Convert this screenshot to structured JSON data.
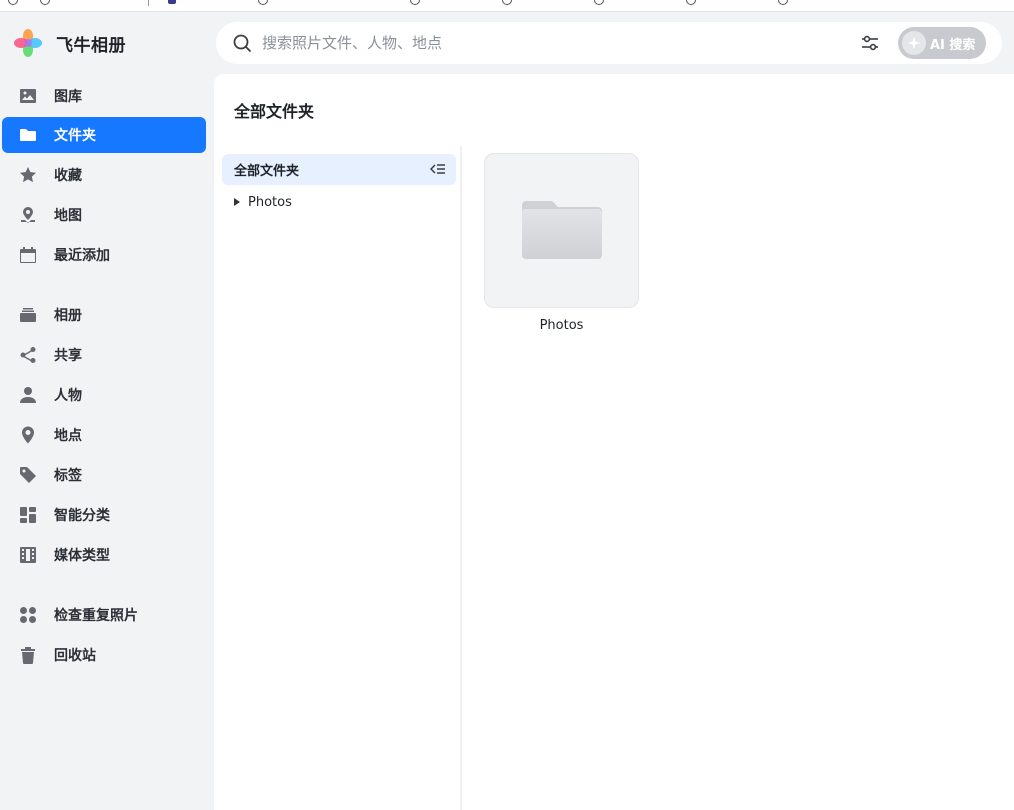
{
  "app": {
    "name": "飞牛相册"
  },
  "search": {
    "placeholder": "搜索照片文件、人物、地点",
    "ai_label": "AI 搜索"
  },
  "nav": {
    "gallery": "图库",
    "folders": "文件夹",
    "favorites": "收藏",
    "map": "地图",
    "recent": "最近添加",
    "albums": "相册",
    "share": "共享",
    "people": "人物",
    "places": "地点",
    "tags": "标签",
    "smart": "智能分类",
    "media_types": "媒体类型",
    "duplicates": "检查重复照片",
    "trash": "回收站"
  },
  "main": {
    "title": "全部文件夹",
    "tree": {
      "root": "全部文件夹",
      "children": [
        "Photos"
      ]
    },
    "folders": [
      {
        "name": "Photos"
      }
    ]
  },
  "colors": {
    "accent": "#1677ff",
    "tree_selected_bg": "#e6f0ff",
    "sidebar_bg": "#f2f3f5"
  }
}
